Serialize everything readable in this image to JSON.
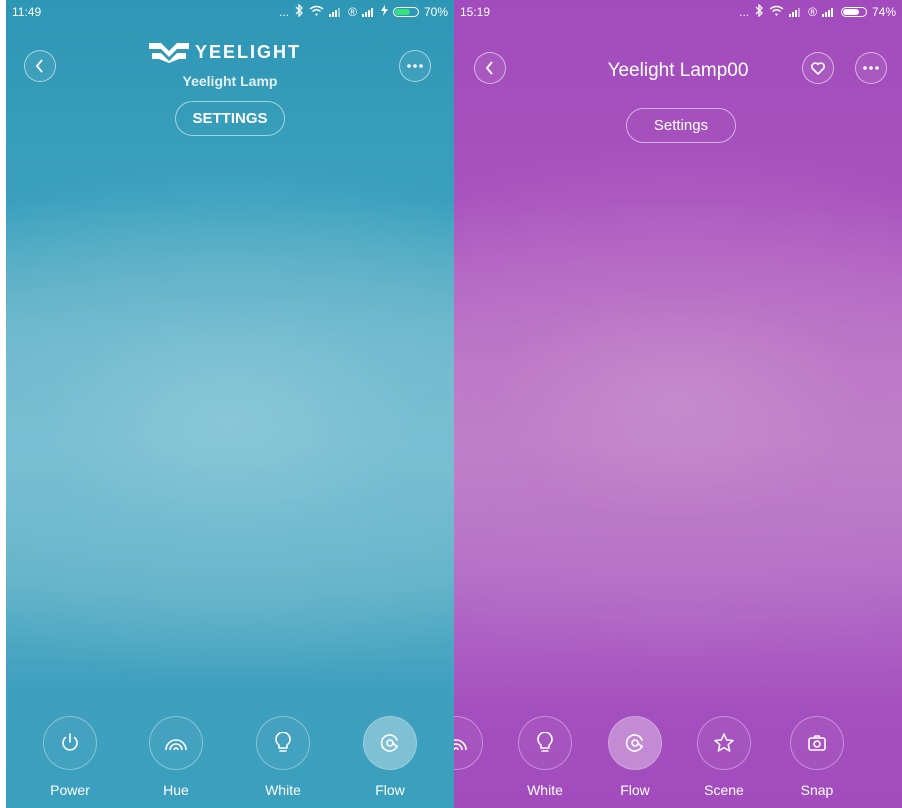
{
  "left_screen": {
    "status": {
      "time": "11:49",
      "dots": "...",
      "registered": "®",
      "battery": "70%",
      "battery_level": 0.7,
      "battery_color": "#36e27a"
    },
    "brand": "YEELIGHT",
    "device_name": "Yeelight Lamp",
    "settings_label": "SETTINGS",
    "toolbar": [
      {
        "label": "Power",
        "icon": "power-icon",
        "active": false
      },
      {
        "label": "Hue",
        "icon": "rainbow-icon",
        "active": false
      },
      {
        "label": "White",
        "icon": "bulb-icon",
        "active": false
      },
      {
        "label": "Flow",
        "icon": "flow-icon",
        "active": true
      }
    ],
    "colors": {
      "top": "#2e97b5",
      "center": "#79bfd1"
    }
  },
  "right_screen": {
    "status": {
      "time": "15:19",
      "dots": "...",
      "registered": "®",
      "battery": "74%",
      "battery_level": 0.74,
      "battery_color": "#ffffff"
    },
    "title": "Yeelight Lamp00",
    "settings_label": "Settings",
    "toolbar": [
      {
        "label": "ue",
        "icon": "rainbow-icon",
        "active": false
      },
      {
        "label": "White",
        "icon": "bulb-icon",
        "active": false
      },
      {
        "label": "Flow",
        "icon": "flow-icon",
        "active": true
      },
      {
        "label": "Scene",
        "icon": "star-icon",
        "active": false
      },
      {
        "label": "Snap",
        "icon": "camera-icon",
        "active": false
      }
    ],
    "colors": {
      "top": "#a24bbd",
      "center": "#c184cb"
    }
  }
}
